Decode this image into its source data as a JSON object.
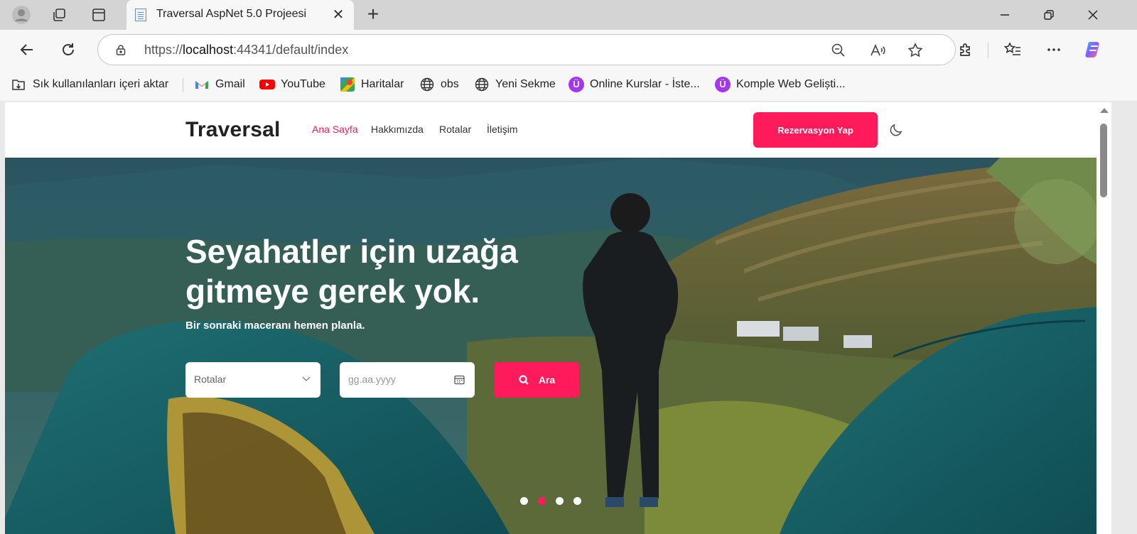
{
  "browser": {
    "tab_title": "Traversal AspNet 5.0 Projeesi",
    "url_prefix": "https://",
    "url_host": "localhost",
    "url_rest": ":44341/default/index"
  },
  "bookmarks": [
    {
      "label": "Sık kullanılanları içeri aktar",
      "icon": "import-icon"
    },
    {
      "label": "Gmail",
      "icon": "gmail-icon"
    },
    {
      "label": "YouTube",
      "icon": "youtube-icon"
    },
    {
      "label": "Haritalar",
      "icon": "maps-icon"
    },
    {
      "label": "obs",
      "icon": "globe-icon"
    },
    {
      "label": "Yeni Sekme",
      "icon": "globe-icon"
    },
    {
      "label": "Online Kurslar - İste...",
      "icon": "udemy-icon"
    },
    {
      "label": "Komple Web Geliști...",
      "icon": "udemy-icon"
    }
  ],
  "site": {
    "logo": "Traversal",
    "menu": [
      "Ana Sayfa",
      "Hakkımızda",
      "Rotalar",
      "İletişim"
    ],
    "reserve_button": "Rezervasyon Yap",
    "accent_color": "#ff1a5b"
  },
  "hero": {
    "title": "Seyahatler için uzağa gitmeye gerek yok.",
    "subtitle": "Bir sonraki maceranı hemen planla.",
    "route_select": "Rotalar",
    "date_placeholder": "gg.aa.yyyy",
    "search_button": "Ara",
    "slides_count": 4,
    "active_slide": 2
  }
}
